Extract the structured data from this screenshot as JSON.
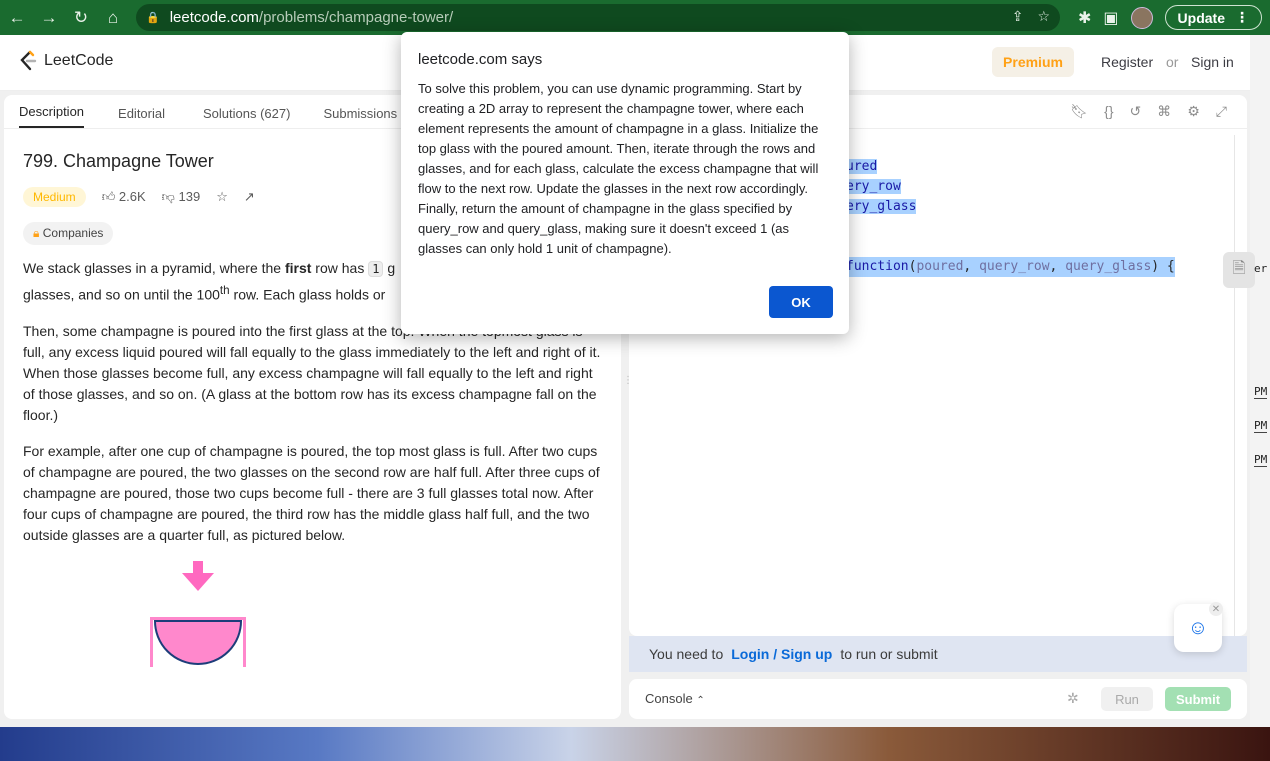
{
  "browser": {
    "url_host": "leetcode.com",
    "url_path": "/problems/champagne-tower/",
    "update_label": "Update"
  },
  "nav": {
    "logo_text": "LeetCode",
    "premium": "Premium",
    "register": "Register",
    "or": "or",
    "signin": "Sign in"
  },
  "tabs": [
    {
      "label": "Description"
    },
    {
      "label": "Editorial"
    },
    {
      "label": "Solutions (627)"
    },
    {
      "label": "Submissions"
    }
  ],
  "problem": {
    "title": "799. Champagne Tower",
    "difficulty": "Medium",
    "likes": "2.6K",
    "dislikes": "139",
    "companies": "Companies",
    "p1_a": "We stack glasses in a pyramid, where the ",
    "p1_bold": "first",
    "p1_b": " row has ",
    "p1_code": "1",
    "p1_c": " g",
    "p1_d": "glasses, and so on until the 100",
    "p1_sup": "th",
    "p1_e": " row.  Each glass holds or",
    "p2": "Then, some champagne is poured into the first glass at the top.  When the topmost glass is full, any excess liquid poured will fall equally to the glass immediately to the left and right of it.  When those glasses become full, any excess champagne will fall equally to the left and right of those glasses, and so on.  (A glass at the bottom row has its excess champagne fall on the floor.)",
    "p3": "For example, after one cup of champagne is poured, the top most glass is full.  After two cups of champagne are poured, the two glasses on the second row are half full.  After three cups of champagne are poured, those two cups become full - there are 3 full glasses total now.  After four cups of champagne are poured, the third row has the middle glass half full, and the two outside glasses are a quarter full, as pictured below."
  },
  "editor": {
    "line1": "ured",
    "line2": "ery_row",
    "line3": "ery_glass",
    "fn_kw": "function",
    "fn_open": "(",
    "arg1": "poured",
    "sep1": ", ",
    "arg2": "query_row",
    "sep2": ", ",
    "arg3": "query_glass",
    "fn_close": ") {"
  },
  "login_bar": {
    "prefix": "You need to",
    "link": "Login / Sign up",
    "suffix": "to run or submit"
  },
  "bottom": {
    "console": "Console",
    "run": "Run",
    "submit": "Submit"
  },
  "side": {
    "pm": "PM",
    "partial": "er"
  },
  "dialog": {
    "title": "leetcode.com says",
    "message": "To solve this problem, you can use dynamic programming. Start by creating a 2D array to represent the champagne tower, where each element represents the amount of champagne in a glass. Initialize the top glass with the poured amount. Then, iterate through the rows and glasses, and for each glass, calculate the excess champagne that will flow to the next row. Update the glasses in the next row accordingly. Finally, return the amount of champagne in the glass specified by query_row and query_glass, making sure it doesn't exceed 1 (as glasses can only hold 1 unit of champagne).",
    "ok": "OK"
  },
  "colors": {
    "accent_premium": "#ffa116",
    "medium": "#ffb800",
    "ok_button": "#0b57d0",
    "chrome_bar": "#1a6b2f",
    "glass_pink": "#ff88cc"
  }
}
